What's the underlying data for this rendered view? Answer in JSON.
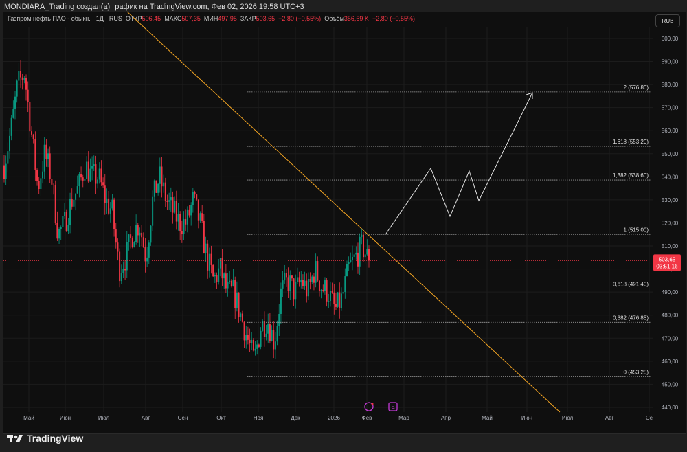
{
  "header": {
    "title": "MONDIARA_Trading создал(а) график на TradingView.com, Фев 02, 2026 19:58 UTC+3"
  },
  "legend": {
    "symbol": "Газпром нефть ПАО - обыкн. · 1Д · RUS",
    "open_label": "ОТКР",
    "open": "506,45",
    "high_label": "МАКС",
    "high": "507,35",
    "low_label": "МИН",
    "low": "497,95",
    "close_label": "ЗАКР",
    "close": "503,65",
    "change": "−2,80 (−0,55%)",
    "volume_label": "Объём",
    "volume": "356,69 K",
    "volume_change": "−2,80 (−0,55%)"
  },
  "currency_button": "RUB",
  "price_axis": {
    "ticks": [
      "600,00",
      "590,00",
      "580,00",
      "570,00",
      "560,00",
      "550,00",
      "540,00",
      "530,00",
      "520,00",
      "510,00",
      "500,00",
      "490,00",
      "480,00",
      "470,00",
      "460,00",
      "450,00",
      "440,00"
    ],
    "current_price": "503,65",
    "countdown": "03:51:16"
  },
  "time_axis": [
    "Май",
    "Июн",
    "Июл",
    "Авг",
    "Сен",
    "Окт",
    "Ноя",
    "Дек",
    "2026",
    "Фев",
    "Мар",
    "Апр",
    "Май",
    "Июн",
    "Июл",
    "Авг",
    "Се"
  ],
  "fib_levels": [
    {
      "label": "2 (576,80)",
      "price": 576.8
    },
    {
      "label": "1,618 (553,20)",
      "price": 553.2
    },
    {
      "label": "1,382 (538,60)",
      "price": 538.6
    },
    {
      "label": "1 (515,00)",
      "price": 515.0
    },
    {
      "label": "0,618 (491,40)",
      "price": 491.4
    },
    {
      "label": "0,382 (476,85)",
      "price": 476.85
    },
    {
      "label": "0 (453,25)",
      "price": 453.25
    }
  ],
  "price_path": [
    545,
    560,
    580,
    585,
    560,
    535,
    550,
    540,
    515,
    520,
    530,
    535,
    545,
    540,
    540,
    530,
    525,
    500,
    505,
    515,
    520,
    505,
    530,
    540,
    530,
    525,
    520,
    520,
    530,
    520,
    505,
    495,
    500,
    490,
    490,
    480,
    470,
    460,
    475,
    478,
    468,
    490,
    495,
    490,
    495,
    490,
    500,
    492,
    490,
    482,
    487,
    500,
    505,
    510,
    503.65
  ],
  "colors": {
    "up": "#089981",
    "down": "#f23645",
    "trendline": "#f5a623",
    "fib": "#9a9a9a",
    "projection": "#e6e6e6",
    "event": "#c43ad6"
  },
  "footer": {
    "brand": "TradingView"
  }
}
